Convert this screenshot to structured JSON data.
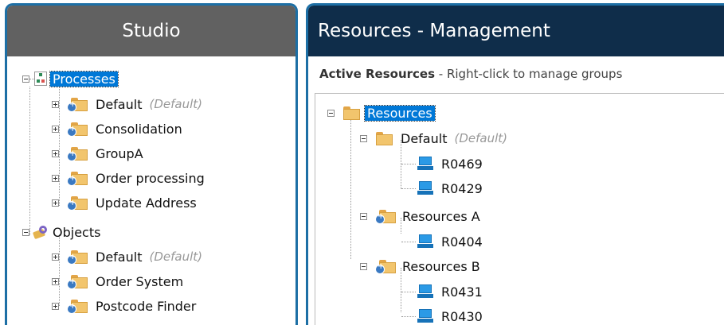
{
  "studio": {
    "title": "Studio",
    "processes": {
      "label": "Processes",
      "items": [
        {
          "label": "Default",
          "note": "(Default)"
        },
        {
          "label": "Consolidation"
        },
        {
          "label": "GroupA"
        },
        {
          "label": "Order processing"
        },
        {
          "label": "Update Address"
        }
      ]
    },
    "objects": {
      "label": "Objects",
      "items": [
        {
          "label": "Default",
          "note": "(Default)"
        },
        {
          "label": "Order System"
        },
        {
          "label": "Postcode Finder"
        }
      ]
    }
  },
  "resources_panel": {
    "title": "Resources - Management",
    "subhead_bold": "Active Resources",
    "subhead_rest": " - Right-click to manage groups",
    "root_label": "Resources",
    "groups": [
      {
        "label": "Default",
        "note": "(Default)",
        "items": [
          "R0469",
          "R0429"
        ]
      },
      {
        "label": "Resources A",
        "items": [
          "R0404"
        ]
      },
      {
        "label": "Resources B",
        "items": [
          "R0431",
          "R0430"
        ]
      }
    ]
  },
  "colors": {
    "accent_border": "#1d6fa5",
    "studio_header": "#616161",
    "resources_header": "#0f2d4a",
    "selection": "#0078d7"
  },
  "icons": {
    "processes": "process-diagram-icon",
    "objects": "objects-icon",
    "group": "group-folder-icon",
    "resource": "computer-icon"
  }
}
